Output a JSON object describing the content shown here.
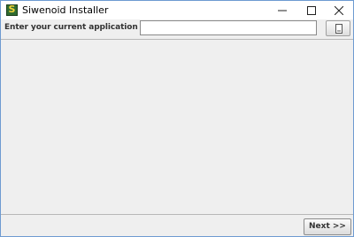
{
  "window": {
    "title": "Siwenoid Installer",
    "icon": "siwenoid-app-icon",
    "icon_letter": "S",
    "controls": [
      "minimize-icon",
      "maximize-icon",
      "close-icon"
    ]
  },
  "toolbar": {
    "version_label": "Enter your current application version:",
    "version_value": "",
    "version_placeholder": "",
    "browse_icon": "file-browse-icon"
  },
  "footer": {
    "next_label": "Next >>"
  },
  "colors": {
    "window_border": "#6e9bd1",
    "background": "#efefef",
    "icon_green": "#2f6b2f",
    "icon_yellow": "#f2d33a"
  }
}
